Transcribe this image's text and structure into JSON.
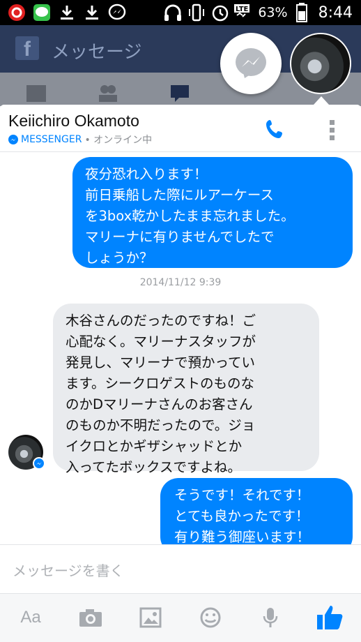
{
  "status_bar": {
    "battery_percent": "63%",
    "time": "8:44",
    "network": "LTE"
  },
  "background_app": {
    "title": "メッセージ"
  },
  "conversation": {
    "contact_name": "Keiichiro Okamoto",
    "source_label": "MESSENGER",
    "presence": "• オンライン中",
    "timestamp": "2014/11/12 9:39",
    "messages": [
      {
        "direction": "out",
        "text": "夜分恐れ入ります！\n前日乗船した際にルアーケース\nを3box乾かしたまま忘れました。\nマリーナに有りませんでしたで\nしょうか？"
      },
      {
        "direction": "in",
        "text": "木谷さんのだったのですね！ご\n心配なく。マリーナスタッフが\n発見し、マリーナで預かってい\nます。シークロゲストのものな\nのかDマリーナさんのお客さん\nのものか不明だったので。ジョ\nイクロとかギザシャッドとか\n入ってたボックスですよね。"
      },
      {
        "direction": "out",
        "text": "そうです！それです！\nとても良かったです！\n有り難う御座います！"
      }
    ]
  },
  "composer": {
    "placeholder": "メッセージを書く"
  },
  "toolbar": {
    "text_size_label": "Aa"
  },
  "colors": {
    "messenger_blue": "#0084ff",
    "incoming_bubble": "#e9ebee",
    "facebook_header": "#2b3a5a"
  }
}
